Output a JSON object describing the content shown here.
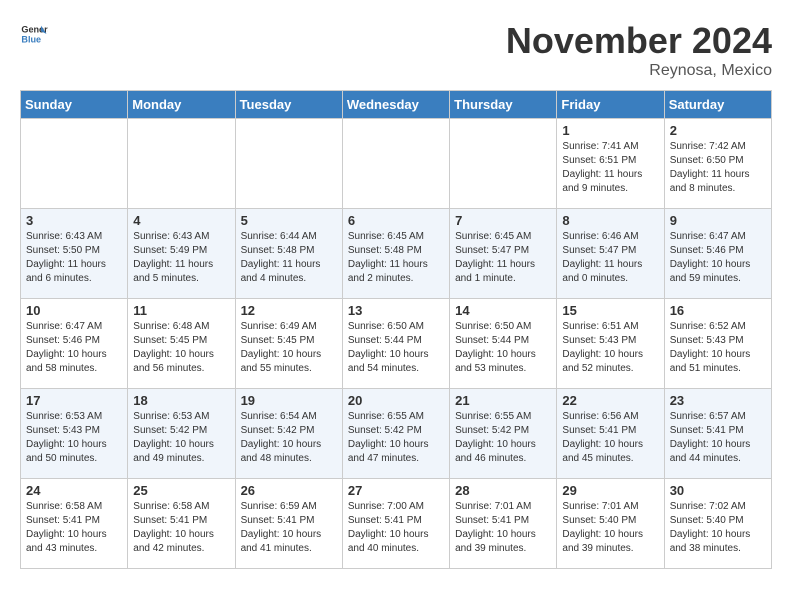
{
  "header": {
    "logo_line1": "General",
    "logo_line2": "Blue",
    "month_title": "November 2024",
    "location": "Reynosa, Mexico"
  },
  "weekdays": [
    "Sunday",
    "Monday",
    "Tuesday",
    "Wednesday",
    "Thursday",
    "Friday",
    "Saturday"
  ],
  "weeks": [
    [
      {
        "num": "",
        "info": ""
      },
      {
        "num": "",
        "info": ""
      },
      {
        "num": "",
        "info": ""
      },
      {
        "num": "",
        "info": ""
      },
      {
        "num": "",
        "info": ""
      },
      {
        "num": "1",
        "info": "Sunrise: 7:41 AM\nSunset: 6:51 PM\nDaylight: 11 hours and 9 minutes."
      },
      {
        "num": "2",
        "info": "Sunrise: 7:42 AM\nSunset: 6:50 PM\nDaylight: 11 hours and 8 minutes."
      }
    ],
    [
      {
        "num": "3",
        "info": "Sunrise: 6:43 AM\nSunset: 5:50 PM\nDaylight: 11 hours and 6 minutes."
      },
      {
        "num": "4",
        "info": "Sunrise: 6:43 AM\nSunset: 5:49 PM\nDaylight: 11 hours and 5 minutes."
      },
      {
        "num": "5",
        "info": "Sunrise: 6:44 AM\nSunset: 5:48 PM\nDaylight: 11 hours and 4 minutes."
      },
      {
        "num": "6",
        "info": "Sunrise: 6:45 AM\nSunset: 5:48 PM\nDaylight: 11 hours and 2 minutes."
      },
      {
        "num": "7",
        "info": "Sunrise: 6:45 AM\nSunset: 5:47 PM\nDaylight: 11 hours and 1 minute."
      },
      {
        "num": "8",
        "info": "Sunrise: 6:46 AM\nSunset: 5:47 PM\nDaylight: 11 hours and 0 minutes."
      },
      {
        "num": "9",
        "info": "Sunrise: 6:47 AM\nSunset: 5:46 PM\nDaylight: 10 hours and 59 minutes."
      }
    ],
    [
      {
        "num": "10",
        "info": "Sunrise: 6:47 AM\nSunset: 5:46 PM\nDaylight: 10 hours and 58 minutes."
      },
      {
        "num": "11",
        "info": "Sunrise: 6:48 AM\nSunset: 5:45 PM\nDaylight: 10 hours and 56 minutes."
      },
      {
        "num": "12",
        "info": "Sunrise: 6:49 AM\nSunset: 5:45 PM\nDaylight: 10 hours and 55 minutes."
      },
      {
        "num": "13",
        "info": "Sunrise: 6:50 AM\nSunset: 5:44 PM\nDaylight: 10 hours and 54 minutes."
      },
      {
        "num": "14",
        "info": "Sunrise: 6:50 AM\nSunset: 5:44 PM\nDaylight: 10 hours and 53 minutes."
      },
      {
        "num": "15",
        "info": "Sunrise: 6:51 AM\nSunset: 5:43 PM\nDaylight: 10 hours and 52 minutes."
      },
      {
        "num": "16",
        "info": "Sunrise: 6:52 AM\nSunset: 5:43 PM\nDaylight: 10 hours and 51 minutes."
      }
    ],
    [
      {
        "num": "17",
        "info": "Sunrise: 6:53 AM\nSunset: 5:43 PM\nDaylight: 10 hours and 50 minutes."
      },
      {
        "num": "18",
        "info": "Sunrise: 6:53 AM\nSunset: 5:42 PM\nDaylight: 10 hours and 49 minutes."
      },
      {
        "num": "19",
        "info": "Sunrise: 6:54 AM\nSunset: 5:42 PM\nDaylight: 10 hours and 48 minutes."
      },
      {
        "num": "20",
        "info": "Sunrise: 6:55 AM\nSunset: 5:42 PM\nDaylight: 10 hours and 47 minutes."
      },
      {
        "num": "21",
        "info": "Sunrise: 6:55 AM\nSunset: 5:42 PM\nDaylight: 10 hours and 46 minutes."
      },
      {
        "num": "22",
        "info": "Sunrise: 6:56 AM\nSunset: 5:41 PM\nDaylight: 10 hours and 45 minutes."
      },
      {
        "num": "23",
        "info": "Sunrise: 6:57 AM\nSunset: 5:41 PM\nDaylight: 10 hours and 44 minutes."
      }
    ],
    [
      {
        "num": "24",
        "info": "Sunrise: 6:58 AM\nSunset: 5:41 PM\nDaylight: 10 hours and 43 minutes."
      },
      {
        "num": "25",
        "info": "Sunrise: 6:58 AM\nSunset: 5:41 PM\nDaylight: 10 hours and 42 minutes."
      },
      {
        "num": "26",
        "info": "Sunrise: 6:59 AM\nSunset: 5:41 PM\nDaylight: 10 hours and 41 minutes."
      },
      {
        "num": "27",
        "info": "Sunrise: 7:00 AM\nSunset: 5:41 PM\nDaylight: 10 hours and 40 minutes."
      },
      {
        "num": "28",
        "info": "Sunrise: 7:01 AM\nSunset: 5:41 PM\nDaylight: 10 hours and 39 minutes."
      },
      {
        "num": "29",
        "info": "Sunrise: 7:01 AM\nSunset: 5:40 PM\nDaylight: 10 hours and 39 minutes."
      },
      {
        "num": "30",
        "info": "Sunrise: 7:02 AM\nSunset: 5:40 PM\nDaylight: 10 hours and 38 minutes."
      }
    ]
  ]
}
